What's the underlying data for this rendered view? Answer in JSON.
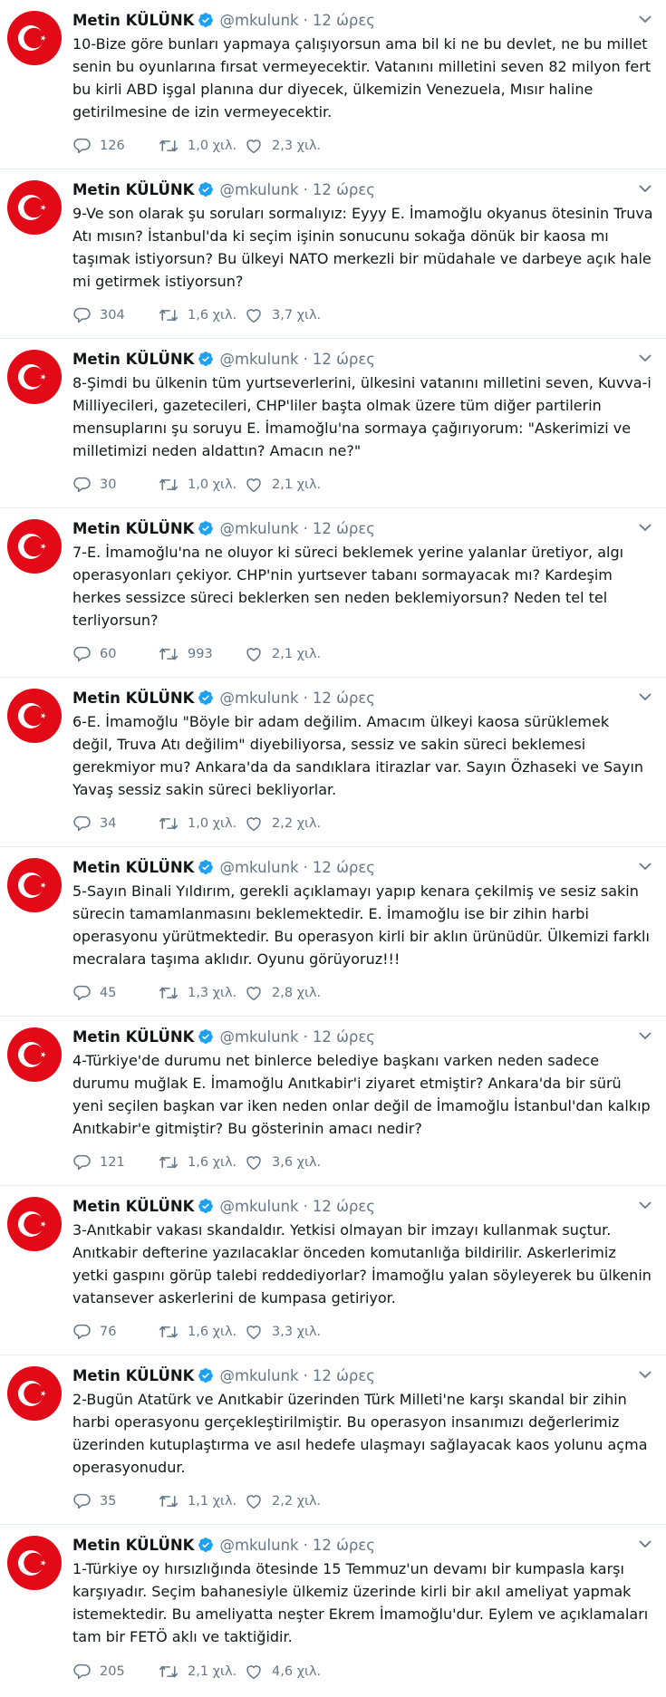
{
  "author": {
    "name": "Metin KÜLÜNK",
    "handle": "@mkulunk",
    "separator": "·"
  },
  "tweets": [
    {
      "time": "12 ώρες",
      "text": "10-Bize göre bunları yapmaya çalışıyorsun ama bil ki ne bu devlet, ne bu millet senin bu oyunlarına fırsat vermeyecektir. Vatanını milletini seven 82 milyon fert bu kirli ABD işgal planına dur diyecek, ülkemizin Venezuela, Mısır haline getirilmesine de izin vermeyecektir.",
      "replies": "126",
      "retweets": "1,0 χιλ.",
      "likes": "2,3 χιλ."
    },
    {
      "time": "12 ώρες",
      "text": "9-Ve son olarak şu soruları sormalıyız: Eyyy E. İmamoğlu okyanus ötesinin Truva Atı mısın? İstanbul'da ki seçim işinin sonucunu sokağa dönük bir kaosa mı taşımak istiyorsun? Bu ülkeyi NATO merkezli bir müdahale ve darbeye açık hale mi getirmek istiyorsun?",
      "replies": "304",
      "retweets": "1,6 χιλ.",
      "likes": "3,7 χιλ."
    },
    {
      "time": "12 ώρες",
      "text": "8-Şimdi bu ülkenin tüm yurtseverlerini, ülkesini vatanını milletini seven, Kuvva-i Milliyecileri, gazetecileri, CHP'liler başta olmak üzere tüm diğer partilerin mensuplarını şu soruyu E. İmamoğlu'na sormaya çağırıyorum: \"Askerimizi ve milletimizi neden aldattın? Amacın ne?\"",
      "replies": "30",
      "retweets": "1,0 χιλ.",
      "likes": "2,1 χιλ."
    },
    {
      "time": "12 ώρες",
      "text": "7-E. İmamoğlu'na ne oluyor ki süreci beklemek yerine yalanlar üretiyor, algı operasyonları çekiyor. CHP'nin yurtsever tabanı sormayacak mı? Kardeşim herkes sessizce süreci beklerken sen neden beklemiyorsun? Neden tel tel terliyorsun?",
      "replies": "60",
      "retweets": "993",
      "likes": "2,1 χιλ."
    },
    {
      "time": "12 ώρες",
      "text": "6-E. İmamoğlu \"Böyle bir adam değilim. Amacım ülkeyi kaosa sürüklemek değil, Truva Atı değilim\" diyebiliyorsa, sessiz ve sakin süreci beklemesi gerekmiyor mu? Ankara'da da sandıklara itirazlar var. Sayın Özhaseki ve Sayın Yavaş sessiz sakin süreci bekliyorlar.",
      "replies": "34",
      "retweets": "1,0 χιλ.",
      "likes": "2,2 χιλ."
    },
    {
      "time": "12 ώρες",
      "text": "5-Sayın Binali Yıldırım, gerekli açıklamayı yapıp kenara çekilmiş ve sesiz sakin sürecin tamamlanmasını beklemektedir. E. İmamoğlu ise bir zihin harbi operasyonu yürütmektedir. Bu operasyon kirli bir aklın ürünüdür. Ülkemizi farklı mecralara taşıma aklıdır. Oyunu görüyoruz!!!",
      "replies": "45",
      "retweets": "1,3 χιλ.",
      "likes": "2,8 χιλ."
    },
    {
      "time": "12 ώρες",
      "text": "4-Türkiye'de durumu net binlerce belediye başkanı varken neden sadece durumu muğlak E. İmamoğlu Anıtkabir'i ziyaret etmiştir? Ankara'da bir sürü yeni seçilen başkan var iken neden onlar değil de İmamoğlu İstanbul'dan kalkıp Anıtkabir'e gitmiştir? Bu gösterinin amacı nedir?",
      "replies": "121",
      "retweets": "1,6 χιλ.",
      "likes": "3,6 χιλ."
    },
    {
      "time": "12 ώρες",
      "text": "3-Anıtkabir vakası skandaldır. Yetkisi olmayan bir imzayı kullanmak suçtur. Anıtkabir defterine yazılacaklar önceden komutanlığa bildirilir. Askerlerimiz yetki gaspını görüp talebi reddediyorlar? İmamoğlu yalan söyleyerek bu ülkenin vatansever askerlerini de kumpasa getiriyor.",
      "replies": "76",
      "retweets": "1,6 χιλ.",
      "likes": "3,3 χιλ."
    },
    {
      "time": "12 ώρες",
      "text": "2-Bugün Atatürk ve Anıtkabir üzerinden Türk Milleti'ne karşı skandal bir zihin harbi operasyonu gerçekleştirilmiştir. Bu operasyon insanımızı değerlerimiz üzerinden kutuplaştırma ve asıl hedefe ulaşmayı sağlayacak kaos yolunu açma operasyonudur.",
      "replies": "35",
      "retweets": "1,1 χιλ.",
      "likes": "2,2 χιλ."
    },
    {
      "time": "12 ώρες",
      "text": "1-Türkiye oy hırsızlığında ötesinde 15 Temmuz'un devamı bir kumpasla karşı karşıyadır. Seçim bahanesiyle ülkemiz üzerinde kirli bir akıl ameliyat yapmak istemektedir.  Bu ameliyatta neşter Ekrem İmamoğlu'dur. Eylem ve açıklamaları tam bir FETÖ aklı ve taktiğidir.",
      "replies": "205",
      "retweets": "2,1 χιλ.",
      "likes": "4,6 χιλ."
    }
  ],
  "icons": {
    "avatar": "turkish-flag-icon",
    "verified": "verified-badge-icon",
    "menu": "chevron-down-icon",
    "reply": "reply-icon",
    "retweet": "retweet-icon",
    "like": "heart-icon"
  },
  "colors": {
    "flag_red": "#e30a17",
    "verified_blue": "#1da1f2",
    "secondary_text": "#657786",
    "divider": "#e6ecf0"
  }
}
